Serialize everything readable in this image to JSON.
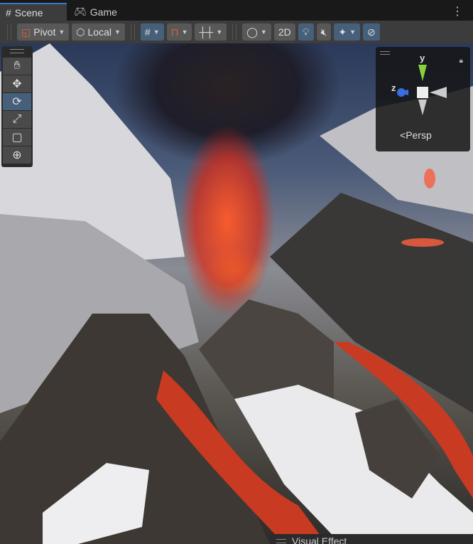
{
  "tabs": [
    {
      "label": "Scene",
      "icon": "grid-icon",
      "active": true
    },
    {
      "label": "Game",
      "icon": "gamepad-icon",
      "active": false
    }
  ],
  "toolbar": {
    "pivot": "Pivot",
    "local": "Local",
    "mode_2d": "2D"
  },
  "tools": [
    "hand-tool",
    "move-tool",
    "rotate-tool",
    "scale-tool",
    "rect-tool",
    "transform-tool"
  ],
  "selected_tool": "rotate-tool",
  "gizmo": {
    "y": "y",
    "z": "z",
    "projection": "Persp"
  },
  "overlay": {
    "title": "Visual Effect"
  },
  "colors": {
    "accent": "#46607c",
    "tab_highlight": "#3a79bb"
  }
}
